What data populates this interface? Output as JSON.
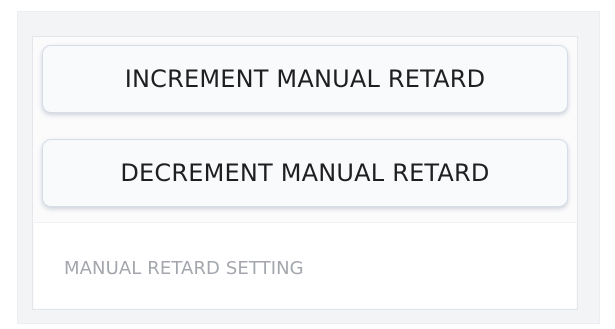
{
  "controls": {
    "increment_label": "INCREMENT MANUAL RETARD",
    "decrement_label": "DECREMENT MANUAL RETARD"
  },
  "setting": {
    "placeholder": "MANUAL RETARD SETTING",
    "value": ""
  },
  "colors": {
    "button_text": "#1f1f1f",
    "button_border": "#d6dde6",
    "placeholder_text": "#a3a7ad",
    "background": "#f3f4f6"
  }
}
